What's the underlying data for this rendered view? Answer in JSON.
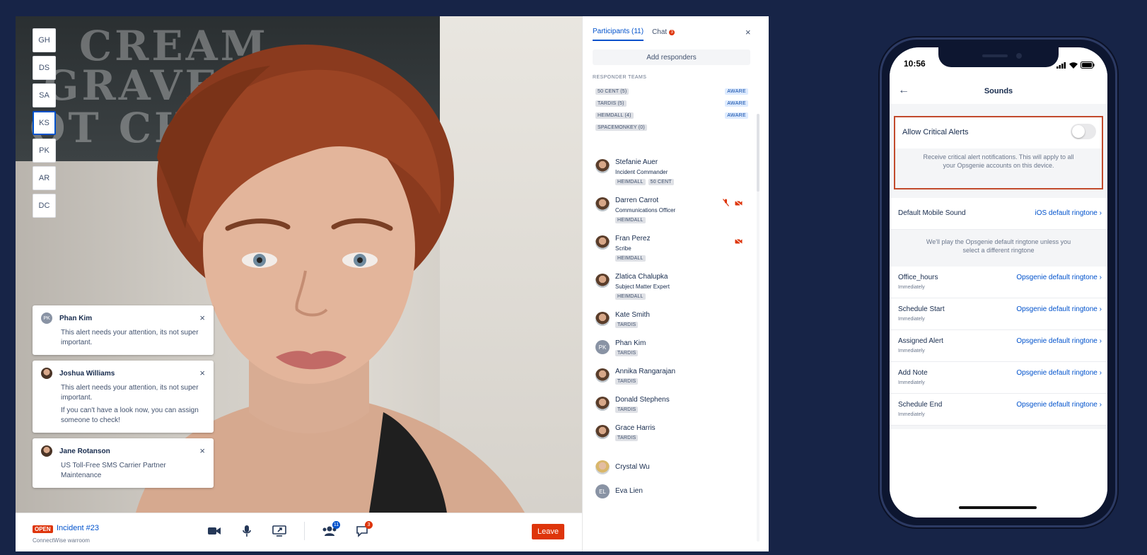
{
  "conference": {
    "avatars": [
      "GH",
      "DS",
      "SA",
      "KS",
      "PK",
      "AR",
      "DC"
    ],
    "active_avatar": "KS",
    "background_text": [
      "CREAM",
      "GRAVE",
      "OT CH"
    ],
    "notifications": [
      {
        "initials": "PK",
        "name": "Phan Kim",
        "lines": [
          "This alert needs your attention, its not super important."
        ]
      },
      {
        "initials": "",
        "name": "Joshua Williams",
        "lines": [
          "This alert needs your attention, its not super important.",
          "If you can't have a look now, you can assign someone to check!"
        ]
      },
      {
        "initials": "",
        "name": "Jane Rotanson",
        "lines": [
          "US Toll-Free SMS Carrier Partner Maintenance"
        ]
      }
    ],
    "bottom": {
      "status": "OPEN",
      "incident": "Incident #23",
      "subtitle": "ConnectWise warroom",
      "participants_badge": "11",
      "chat_badge": "3",
      "leave_label": "Leave"
    }
  },
  "panel": {
    "tab_participants": "Participants (11)",
    "tab_chat": "Chat",
    "chat_badge": "3",
    "add_responders": "Add responders",
    "responder_heading": "RESPONDER TEAMS",
    "teams": [
      {
        "name": "50 CENT (5)",
        "aware": "AWARE"
      },
      {
        "name": "TARDIS (5)",
        "aware": "AWARE"
      },
      {
        "name": "HEIMDALL (4)",
        "aware": "AWARE"
      },
      {
        "name": "SPACEMONKEY (0)",
        "aware": ""
      }
    ],
    "participants": [
      {
        "name": "Stefanie Auer",
        "role": "Incident Commander",
        "tags": [
          "HEIMDALL",
          "50 CENT"
        ],
        "initials": "",
        "icons": []
      },
      {
        "name": "Darren Carrot",
        "role": "Communications Officer",
        "tags": [
          "HEIMDALL"
        ],
        "initials": "",
        "icons": [
          "mic-muted-icon",
          "camera-off-icon"
        ]
      },
      {
        "name": "Fran Perez",
        "role": "Scribe",
        "tags": [
          "HEIMDALL"
        ],
        "initials": "",
        "icons": [
          "camera-off-icon"
        ]
      },
      {
        "name": "Zlatica Chalupka",
        "role": "Subject Matter Expert",
        "tags": [
          "HEIMDALL"
        ],
        "initials": "",
        "icons": []
      },
      {
        "name": "Kate Smith",
        "role": "",
        "tags": [
          "TARDIS"
        ],
        "initials": "",
        "icons": []
      },
      {
        "name": "Phan Kim",
        "role": "",
        "tags": [
          "TARDIS"
        ],
        "initials": "PK",
        "icons": []
      },
      {
        "name": "Annika Rangarajan",
        "role": "",
        "tags": [
          "TARDIS"
        ],
        "initials": "",
        "icons": []
      },
      {
        "name": "Donald Stephens",
        "role": "",
        "tags": [
          "TARDIS"
        ],
        "initials": "",
        "icons": []
      },
      {
        "name": "Grace Harris",
        "role": "",
        "tags": [
          "TARDIS"
        ],
        "initials": "",
        "icons": []
      },
      {
        "name": "Crystal Wu",
        "role": "",
        "tags": [],
        "initials": "",
        "icons": []
      },
      {
        "name": "Eva Lien",
        "role": "",
        "tags": [],
        "initials": "EL",
        "icons": []
      }
    ]
  },
  "phone": {
    "time": "10:56",
    "title": "Sounds",
    "critical_label": "Allow Critical Alerts",
    "critical_enabled": false,
    "critical_desc": "Receive critical alert notifications. This will apply to all your Opsgenie accounts on this device.",
    "default_label": "Default Mobile Sound",
    "default_value": "iOS default ringtone",
    "default_help": "We'll play the Opsgenie default ringtone unless you select a different ringtone",
    "rows": [
      {
        "label": "Office_hours",
        "sub": "Immediately",
        "value": "Opsgenie default ringtone"
      },
      {
        "label": "Schedule Start",
        "sub": "Immediately",
        "value": "Opsgenie default ringtone"
      },
      {
        "label": "Assigned Alert",
        "sub": "Immediately",
        "value": "Opsgenie default ringtone"
      },
      {
        "label": "Add Note",
        "sub": "Immediately",
        "value": "Opsgenie default ringtone"
      },
      {
        "label": "Schedule End",
        "sub": "Immediately",
        "value": "Opsgenie default ringtone"
      }
    ]
  },
  "colors": {
    "brand_blue": "#0052cc",
    "danger": "#de350b",
    "page_bg": "#172447",
    "highlight": "#c24a2c"
  }
}
